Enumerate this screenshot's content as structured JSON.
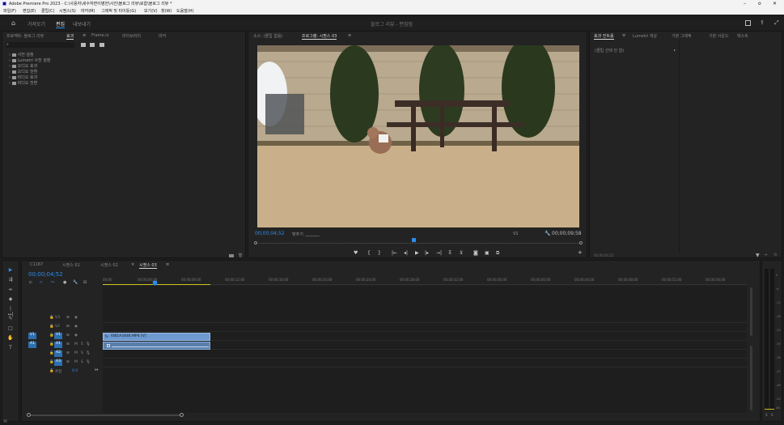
{
  "window": {
    "title": "Adobe Premiere Pro 2023 - C:\\사용자\\세수하면이병헌\\사진\\블로그 리뷰\\로함\\블로그 리뷰 *",
    "controls": [
      "–",
      "o",
      "✕"
    ]
  },
  "menu": [
    "파일(F)",
    "편집(E)",
    "클립(C)",
    "시퀀스(S)",
    "마커(M)",
    "그래픽 및 타이틀(G)",
    "보기(V)",
    "창(W)",
    "도움말(H)"
  ],
  "workspace": {
    "tabs": [
      "가져오기",
      "편집",
      "내보내기"
    ],
    "active_tab": "편집",
    "center_title": "블로그 리뷰 - 편집됨"
  },
  "project_panel": {
    "tabs": [
      "프로젝트: 블로그 리뷰",
      "효과",
      "Frame.io",
      "라이브러리",
      "마커"
    ],
    "active_tab": "효과",
    "search_placeholder": "",
    "items": [
      "사전 설정",
      "Lumetri 사전 설정",
      "오디오 효과",
      "오디오 전환",
      "비디오 효과",
      "비디오 전환"
    ]
  },
  "program_monitor": {
    "tabs": [
      "소스: (클립 없음)",
      "프로그램: 시퀀스 03"
    ],
    "active_tab": "프로그램: 시퀀스 03",
    "current_time": "00;00;04;52",
    "fit_label": "맞추기",
    "track_label": "V1",
    "duration": "00;00;09;58"
  },
  "effect_controls": {
    "tabs": [
      "효과 컨트롤",
      "Lumetri 색상",
      "기본 그래픽",
      "기본 사운드",
      "텍스트"
    ],
    "active_tab": "효과 컨트롤",
    "empty_text": "(클립 선택 안 함)",
    "timecode": "00;00;04;52"
  },
  "timeline": {
    "tabs": [
      "C1167",
      "시퀀스 01",
      "시퀀스 02",
      "시퀀스 03"
    ],
    "active_tab": "시퀀스 03",
    "current_time": "00;00;04;52",
    "ruler": [
      "00;00",
      "00;00;04;00",
      "00;00;08;00",
      "00;00;12;00",
      "00;00;16;00",
      "00;00;20;00",
      "00;00;24;00",
      "00;00;28;00",
      "00;00;32;00",
      "00;00;36;00",
      "00;00;40;00",
      "00;00;44;00",
      "00;00;48;00",
      "00;00;52;00",
      "00;00;56;00"
    ],
    "video_tracks": [
      "V3",
      "V2",
      "V1"
    ],
    "audio_tracks": [
      "A1",
      "A2",
      "A3"
    ],
    "master_label": "혼합",
    "master_value": "0.0",
    "clip_name": "I0B1A3446.MP4 [V]",
    "source_patch_video": "V1",
    "source_patch_audio": "A1"
  },
  "meter": {
    "labels": [
      "0",
      "-6",
      "-12",
      "-18",
      "-24",
      "-30",
      "-36",
      "-42",
      "-48",
      "-54",
      "dB"
    ],
    "solo": [
      "S",
      "S"
    ]
  },
  "colors": {
    "accent_blue": "#2d8ceb",
    "clip_blue": "#6e9ad0",
    "work_area_yellow": "#d2c21c",
    "panel_bg": "#232323"
  }
}
